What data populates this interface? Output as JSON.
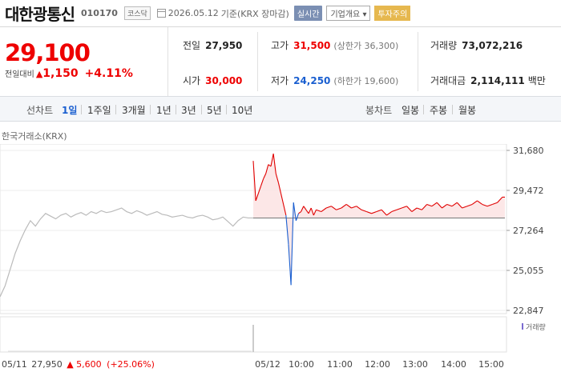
{
  "header": {
    "name": "대한광통신",
    "code": "010170",
    "market": "코스닥",
    "date": "2026.05.12",
    "basis": "기준(KRX 장마감)",
    "realtime": "실시간",
    "corp_info": "기업개요",
    "warning": "투자주의"
  },
  "price": {
    "current": "29,100",
    "change_label": "전일대비",
    "change_symbol": "▲",
    "change": "1,150",
    "change_pct": "+4.11%"
  },
  "stats": {
    "prev_label": "전일",
    "prev": "27,950",
    "high_label": "고가",
    "high": "31,500",
    "upper_limit": "(상한가 36,300)",
    "volume_label": "거래량",
    "volume": "73,072,216",
    "open_label": "시가",
    "open": "30,000",
    "low_label": "저가",
    "low": "24,250",
    "lower_limit": "(하한가 19,600)",
    "amount_label": "거래대금",
    "amount": "2,114,111",
    "amount_unit": "백만"
  },
  "tabs": {
    "line_label": "선차트",
    "periods": [
      "1일",
      "1주일",
      "3개월",
      "1년",
      "3년",
      "5년",
      "10년"
    ],
    "active_period": "1일",
    "candle_label": "봉차트",
    "candles": [
      "일봉",
      "주봉",
      "월봉"
    ]
  },
  "source": "한국거래소(KRX)",
  "footer": {
    "prev_date": "05/11",
    "prev_close": "27,950",
    "prev_symbol": "▲",
    "prev_change": "5,600",
    "prev_pct": "(+25.06%)"
  },
  "colors": {
    "up": "#e00000",
    "down": "#1a5fd0",
    "prev_line": "#bbbbbb",
    "fill": "#fbe3e3"
  },
  "chart_data": {
    "type": "line",
    "y_ticks": [
      "31,680",
      "29,472",
      "27,264",
      "25,055",
      "22,847"
    ],
    "ylim": [
      22847,
      31680
    ],
    "x_ticks": [
      "05/12",
      "10:00",
      "11:00",
      "12:00",
      "13:00",
      "14:00",
      "15:00"
    ],
    "baseline": 27950,
    "volume_label": "거래량",
    "prev_day": {
      "name": "05/11",
      "x": [
        0,
        0.02,
        0.04,
        0.06,
        0.08,
        0.1,
        0.12,
        0.14,
        0.16,
        0.18,
        0.2,
        0.22,
        0.24,
        0.26,
        0.28,
        0.3,
        0.32,
        0.34,
        0.36,
        0.38,
        0.4,
        0.42,
        0.44,
        0.46,
        0.48,
        0.5,
        0.52,
        0.54,
        0.56,
        0.58,
        0.6,
        0.62,
        0.64,
        0.66,
        0.68,
        0.7,
        0.72,
        0.74,
        0.76,
        0.78,
        0.8,
        0.82,
        0.84,
        0.86,
        0.88,
        0.9,
        0.92,
        0.94,
        0.96,
        0.98,
        1
      ],
      "values": [
        23600,
        24200,
        25100,
        26000,
        26700,
        27300,
        27800,
        27500,
        27900,
        28200,
        28050,
        27900,
        28100,
        28200,
        28000,
        28150,
        28250,
        28100,
        28300,
        28200,
        28350,
        28250,
        28300,
        28400,
        28500,
        28300,
        28200,
        28350,
        28250,
        28100,
        28200,
        28300,
        28150,
        28100,
        28000,
        28050,
        28100,
        28000,
        27950,
        28050,
        28100,
        28000,
        27850,
        27900,
        28000,
        27750,
        27500,
        27800,
        28000,
        27950,
        27950
      ]
    },
    "today": {
      "name": "05/12",
      "x": [
        0,
        0.01,
        0.02,
        0.03,
        0.04,
        0.05,
        0.06,
        0.07,
        0.08,
        0.09,
        0.1,
        0.11,
        0.12,
        0.13,
        0.14,
        0.15,
        0.16,
        0.17,
        0.18,
        0.19,
        0.2,
        0.21,
        0.22,
        0.23,
        0.24,
        0.25,
        0.27,
        0.29,
        0.31,
        0.33,
        0.35,
        0.37,
        0.39,
        0.41,
        0.43,
        0.45,
        0.47,
        0.49,
        0.51,
        0.53,
        0.55,
        0.57,
        0.59,
        0.61,
        0.63,
        0.65,
        0.67,
        0.69,
        0.71,
        0.73,
        0.75,
        0.77,
        0.79,
        0.81,
        0.83,
        0.85,
        0.87,
        0.89,
        0.91,
        0.93,
        0.95,
        0.97,
        0.99,
        1
      ],
      "values": [
        31100,
        28900,
        29300,
        29700,
        30100,
        30400,
        30900,
        30800,
        31500,
        30400,
        29900,
        29300,
        28700,
        28100,
        26500,
        24250,
        28800,
        27800,
        28200,
        28300,
        28600,
        28400,
        28200,
        28500,
        28100,
        28400,
        28300,
        28500,
        28600,
        28400,
        28500,
        28700,
        28500,
        28600,
        28400,
        28300,
        28200,
        28300,
        28400,
        28100,
        28300,
        28400,
        28500,
        28600,
        28300,
        28500,
        28400,
        28700,
        28600,
        28800,
        28500,
        28700,
        28600,
        28800,
        28500,
        28600,
        28700,
        28900,
        28700,
        28600,
        28700,
        28800,
        29100,
        29100
      ]
    }
  }
}
